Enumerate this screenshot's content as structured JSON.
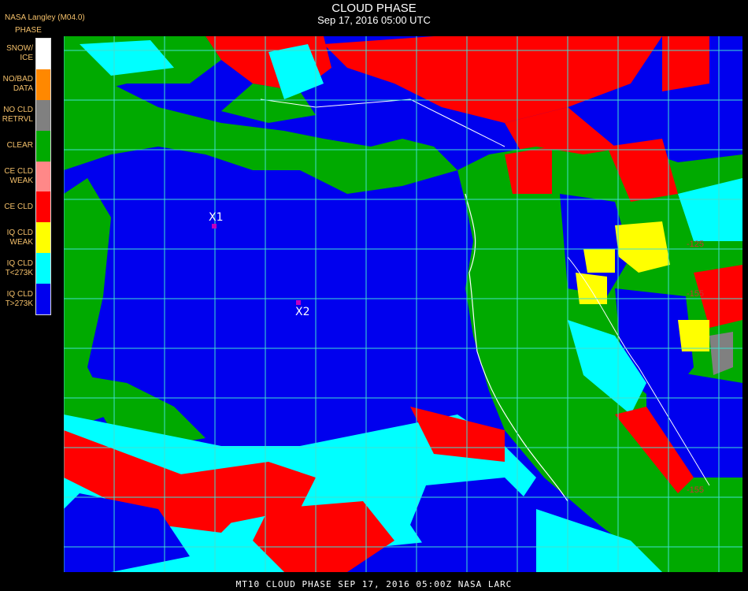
{
  "header": {
    "title": "CLOUD PHASE",
    "subtitle": "Sep 17, 2016 05:00 UTC",
    "provider": "NASA Langley (M04.0)"
  },
  "legend": {
    "title": "PHASE",
    "items": [
      {
        "label": "SNOW/\nICE",
        "color": "#ffffff"
      },
      {
        "label": "NO/BAD\nDATA",
        "color": "#ff8800"
      },
      {
        "label": "NO CLD\nRETRVL",
        "color": "#808080"
      },
      {
        "label": "CLEAR",
        "color": "#00aa00"
      },
      {
        "label": "CE CLD\nWEAK",
        "color": "#ff8888"
      },
      {
        "label": "CE CLD",
        "color": "#ff0000"
      },
      {
        "label": "IQ CLD\nWEAK",
        "color": "#ffff00"
      },
      {
        "label": "IQ CLD\nT<273K",
        "color": "#00ffff"
      },
      {
        "label": "IQ CLD\nT>273K",
        "color": "#0000ee"
      }
    ]
  },
  "markers": [
    {
      "label": "X1"
    },
    {
      "label": "X2"
    }
  ],
  "map_labels": [
    "-125",
    "-155",
    "-155"
  ],
  "footer": "MT10   CLOUD PHASE   SEP 17, 2016 05:00Z   NASA LARC",
  "colors": {
    "grid": "#40e0d0",
    "coastline": "#ffffff",
    "map_label": "#cc3333"
  }
}
